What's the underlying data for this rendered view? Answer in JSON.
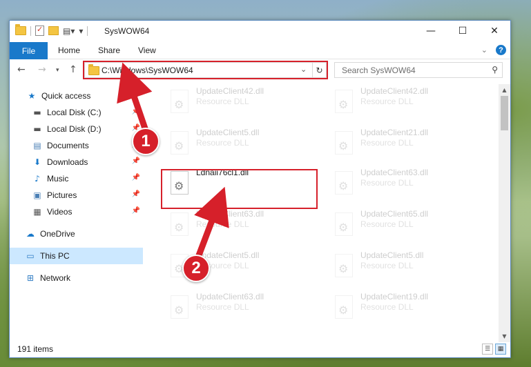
{
  "window": {
    "title": "SysWOW64",
    "buttons": {
      "minimize": "—",
      "maximize": "☐",
      "close": "✕"
    }
  },
  "ribbon": {
    "file_tab": "File",
    "tabs": [
      "Home",
      "Share",
      "View"
    ]
  },
  "address": {
    "path": "C:\\Windows\\SysWOW64",
    "search_placeholder": "Search SysWOW64"
  },
  "sidebar": {
    "items": [
      {
        "label": "Quick access",
        "icon": "star-icon"
      },
      {
        "label": "Local Disk (C:)",
        "icon": "drive-icon",
        "pinned": true
      },
      {
        "label": "Local Disk (D:)",
        "icon": "drive-icon",
        "pinned": true
      },
      {
        "label": "Documents",
        "icon": "documents-icon",
        "pinned": true
      },
      {
        "label": "Downloads",
        "icon": "download-icon",
        "pinned": true
      },
      {
        "label": "Music",
        "icon": "music-icon",
        "pinned": true
      },
      {
        "label": "Pictures",
        "icon": "pictures-icon",
        "pinned": true
      },
      {
        "label": "Videos",
        "icon": "videos-icon",
        "pinned": true
      },
      {
        "label": "OneDrive",
        "icon": "cloud-icon"
      },
      {
        "label": "This PC",
        "icon": "computer-icon",
        "selected": true
      },
      {
        "label": "Network",
        "icon": "network-icon"
      }
    ]
  },
  "files": [
    {
      "name": "UpdateClient42.dll",
      "type": "Resource DLL"
    },
    {
      "name": "UpdateClient42.dll",
      "type": "Resource DLL"
    },
    {
      "name": "UpdateClient5.dll",
      "type": "Resource DLL"
    },
    {
      "name": "UpdateClient21.dll",
      "type": "Resource DLL"
    },
    {
      "name": "Ldnaii76cl1.dll",
      "type": ""
    },
    {
      "name": "UpdateClient63.dll",
      "type": "Resource DLL"
    },
    {
      "name": "UpdateClient63.dll",
      "type": "Resource DLL"
    },
    {
      "name": "UpdateClient65.dll",
      "type": "Resource DLL"
    },
    {
      "name": "UpdateClient5.dll",
      "type": "Resource DLL"
    },
    {
      "name": "UpdateClient5.dll",
      "type": "Resource DLL"
    },
    {
      "name": "UpdateClient63.dll",
      "type": "Resource DLL"
    },
    {
      "name": "UpdateClient19.dll",
      "type": "Resource DLL"
    }
  ],
  "status": {
    "item_count": "191 items"
  },
  "annotations": {
    "step1": "1",
    "step2": "2",
    "color": "#d6202a"
  }
}
